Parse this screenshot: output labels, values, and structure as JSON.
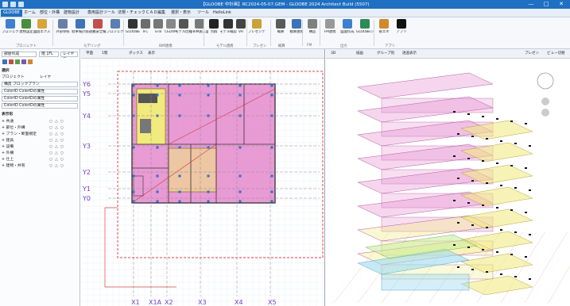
{
  "window": {
    "title": "【GLOOBE 中計画】RC2024-05-07.GEM - GLOOBE 2024 Architect Build (5507)",
    "minimize": "—",
    "maximize": "□",
    "close": "✕"
  },
  "menu": {
    "tabs": [
      {
        "label": "GLOOBE",
        "active": true
      },
      {
        "label": "ホーム"
      },
      {
        "label": "部位・外構"
      },
      {
        "label": "建物設計"
      },
      {
        "label": "専用設計ツール"
      },
      {
        "label": "法規・チェック"
      },
      {
        "label": "ＣＡＤ編集"
      },
      {
        "label": "選択・表示"
      },
      {
        "label": "ツール"
      },
      {
        "label": "HelloLink"
      }
    ]
  },
  "ribbon": {
    "buttons": [
      {
        "label": "プロジェクト",
        "icon": "project-icon",
        "color": "#3f7fd0"
      },
      {
        "label": "建物設定",
        "icon": "building-settings-icon",
        "color": "#4a8d3f"
      },
      {
        "label": "図面エクスプローラー",
        "icon": "explorer-icon",
        "color": "#d9a43b"
      },
      {
        "label": "外部参照",
        "icon": "external-ref-icon",
        "color": "#6a7fa8"
      },
      {
        "label": "駐車場計画",
        "icon": "parking-icon",
        "color": "#3d73b8"
      },
      {
        "label": "避難安全検証",
        "icon": "evacuation-icon",
        "color": "#c0504d"
      },
      {
        "label": "プロジェクトリンク",
        "icon": "project-link-icon",
        "color": "#5b7fb5"
      },
      {
        "label": "GLOOBE",
        "icon": "gloobe-icon",
        "color": "#333333"
      },
      {
        "label": "IFC",
        "icon": "ifc-icon",
        "color": "#6d6d6d"
      },
      {
        "label": "STB",
        "icon": "stb-icon",
        "color": "#777777"
      },
      {
        "label": "CEDXM",
        "icon": "cedxm-icon",
        "color": "#888888"
      },
      {
        "label": "モデル比較",
        "icon": "model-compare-icon",
        "color": "#555555"
      },
      {
        "label": "J-BIM施工図",
        "icon": "jbim-icon",
        "color": "#7a7a7a"
      },
      {
        "label": "点群",
        "icon": "point-cloud-icon",
        "color": "#222222"
      },
      {
        "label": "モデル確認",
        "icon": "model-check-icon",
        "color": "#333333"
      },
      {
        "label": "VR",
        "icon": "vr-icon",
        "color": "#444444"
      },
      {
        "label": "プレゼンデータ作成",
        "icon": "presentation-icon",
        "color": "#c8a23a"
      },
      {
        "label": "概算",
        "icon": "estimate-icon",
        "color": "#5a5a5a"
      },
      {
        "label": "積算連携",
        "icon": "quantity-icon",
        "color": "#3d73b8"
      },
      {
        "label": "構造",
        "icon": "structure-icon",
        "color": "#808080"
      },
      {
        "label": "FM連携",
        "icon": "fm-icon",
        "color": "#999999"
      },
      {
        "label": "図面作成",
        "icon": "drawing-icon",
        "color": "#3f7fd0"
      },
      {
        "label": "GLOOBEシート",
        "icon": "sheet-icon",
        "color": "#2e8b57"
      },
      {
        "label": "省エネ",
        "icon": "energy-icon",
        "color": "#d08a2c"
      },
      {
        "label": "アプリ",
        "icon": "app-icon",
        "color": "#111111"
      }
    ],
    "groups": [
      "プロジェクト",
      "モデリング",
      "BIM連携",
      "モデル連携",
      "プレゼン",
      "概算",
      "FM",
      "出力",
      "アプリ"
    ]
  },
  "left_panel": {
    "top_fields": [
      "部屋作成",
      "階 1FL",
      "レイヤー"
    ],
    "section": "選択",
    "radio_project": "プロジェクト",
    "radio_layer": "レイヤ",
    "filter": "構造 ブロックプラン",
    "colorid_rows": [
      "ColorID ColorIDの属性",
      "ColorID ColorIDの属性",
      "ColorID ColorIDの属性"
    ],
    "header": "表示形",
    "items": [
      "共通",
      "部位・外構",
      "プラン・断面規定",
      "建具",
      "設備",
      "外構",
      "仕上",
      "建物・共有"
    ]
  },
  "view2d": {
    "tabs": [
      "平面",
      "1階",
      "ボックス",
      "表示"
    ],
    "y_labels": [
      "Y6",
      "Y5",
      "Y4",
      "Y3",
      "Y2",
      "Y1",
      "Y0"
    ],
    "x_labels": [
      "X1",
      "X1A",
      "X2",
      "X3",
      "X4",
      "X5"
    ]
  },
  "view3d": {
    "tabs": [
      "3D",
      "描画",
      "グループ別",
      "透過表示",
      "プレゼン",
      "ビュー切替"
    ]
  },
  "colors": {
    "accent": "#1f6fc2",
    "room_pink": "#e58acd",
    "room_yellow": "#f1ea7c",
    "room_cyan": "#9fdcef",
    "room_green": "#c8ec9a"
  }
}
